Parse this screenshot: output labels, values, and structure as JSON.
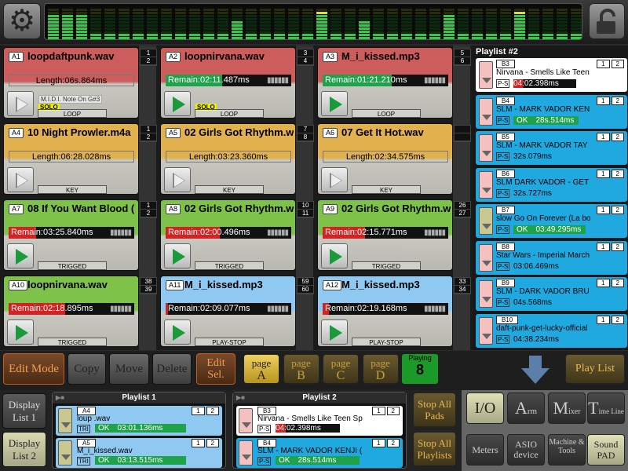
{
  "top": {
    "gear_icon": "gear-icon",
    "lock_icon": "unlock-icon"
  },
  "vu": {
    "levels": [
      0.75,
      0.75,
      0.75,
      0.2,
      0.2,
      0.2,
      0.2,
      0.2,
      0.2,
      0.2,
      0.2,
      0.2,
      0.2,
      0.6,
      0.2,
      0.2,
      0.2,
      0.2,
      0.2,
      0.9,
      0.2,
      0.2,
      0.6,
      0.2,
      0.2,
      0.2,
      0.2,
      0.2,
      0.75,
      0.2,
      0.2,
      0.2,
      0.2,
      0.9,
      0.2,
      0.2,
      0.2,
      0.2
    ]
  },
  "pads": [
    {
      "id": "A1",
      "title": "loopdaftpunk.wav",
      "kind": "len",
      "text": "Length:06s.864ms",
      "mode": "LOOP",
      "color": "#cd5c5c",
      "nums": [
        "1",
        "2"
      ],
      "playing": false,
      "midi": "M.I.D.I. Note On G#3",
      "solo": "SOLO"
    },
    {
      "id": "A2",
      "title": "loopnirvana.wav",
      "kind": "rem",
      "text": "Remain:02:11.487ms",
      "fill": 0.45,
      "fillcolor": "#1ea34a",
      "mode": "LOOP",
      "color": "#cd5c5c",
      "nums": [
        "3",
        "4"
      ],
      "playing": true,
      "solo": "SOLO"
    },
    {
      "id": "A3",
      "title": "M_i_kissed.mp3",
      "kind": "rem",
      "text": "Remain:01:21.210ms",
      "fill": 0.55,
      "fillcolor": "#1ea34a",
      "mode": "LOOP",
      "color": "#cd5c5c",
      "nums": [
        "5",
        "6"
      ],
      "playing": true
    },
    {
      "id": "A4",
      "title": "10 Night Prowler.m4a",
      "kind": "len",
      "text": "Length:06:28.028ms",
      "mode": "KEY",
      "color": "#e2b14e",
      "nums": [
        "1",
        "2"
      ],
      "playing": false
    },
    {
      "id": "A5",
      "title": "02 Girls Got Rhythm.w",
      "kind": "len",
      "text": "Length:03:23.360ms",
      "mode": "KEY",
      "color": "#e2b14e",
      "nums": [
        "7",
        "8"
      ],
      "playing": false
    },
    {
      "id": "A6",
      "title": "07 Get It Hot.wav",
      "kind": "len",
      "text": "Length:02:34.575ms",
      "mode": "KEY",
      "color": "#e2b14e",
      "nums": [
        "",
        ""
      ],
      "playing": false
    },
    {
      "id": "A7",
      "title": "08 If You Want Blood (",
      "kind": "rem",
      "text": "Remain:03:25.840ms",
      "fill": 0.22,
      "fillcolor": "#d42222",
      "mode": "TRIGGED",
      "color": "#7ec24a",
      "nums": [
        "1",
        "2"
      ],
      "playing": true
    },
    {
      "id": "A8",
      "title": "02 Girls Got Rhythm.w",
      "kind": "rem",
      "text": "Remain:02:00.496ms",
      "fill": 0.43,
      "fillcolor": "#d42222",
      "mode": "TRIGGED",
      "color": "#7ec24a",
      "nums": [
        "10",
        "11"
      ],
      "playing": true
    },
    {
      "id": "A9",
      "title": "02 Girls Got Rhythm.w",
      "kind": "rem",
      "text": "Remain:02:15.771ms",
      "fill": 0.34,
      "fillcolor": "#d42222",
      "mode": "TRIGGED",
      "color": "#7ec24a",
      "nums": [
        "26",
        "27"
      ],
      "playing": true
    },
    {
      "id": "A10",
      "title": "loopnirvana.wav",
      "kind": "rem",
      "text": "Remain:02:18.895ms",
      "fill": 0.45,
      "fillcolor": "#d42222",
      "mode": "TRIGGED",
      "color": "#7ec24a",
      "nums": [
        "38",
        "39"
      ],
      "playing": true
    },
    {
      "id": "A11",
      "title": "M_i_kissed.mp3",
      "kind": "rem",
      "text": "Remain:02:09.077ms",
      "fill": 0.02,
      "fillcolor": "#d42222",
      "mode": "PLAY-STOP",
      "color": "#8fc8f0",
      "nums": [
        "59",
        "60"
      ],
      "playing": true
    },
    {
      "id": "A12",
      "title": "M_i_kissed.mp3",
      "kind": "rem",
      "text": "Remain:02:19.168ms",
      "fill": 0.05,
      "fillcolor": "#d42222",
      "mode": "PLAY-STOP",
      "color": "#8fc8f0",
      "nums": [
        "33",
        "34"
      ],
      "playing": true
    }
  ],
  "playlist": {
    "title": "Playlist #2",
    "items": [
      {
        "code": "B3",
        "name": "Nirvana - Smells Like Teen",
        "ps": "P-S",
        "time": "04:02.398ms",
        "fill": 0.35,
        "fillcolor": "#d42222",
        "bg": "#ffffff",
        "btn": "#f4c0c0",
        "r1": "1",
        "r2": "2"
      },
      {
        "code": "B4",
        "name": "SLM - MARK VADOR KEN",
        "ps": "P-S",
        "time": "28s.514ms",
        "status": "OK",
        "fill": 1,
        "fillcolor": "#1ea34a",
        "bg": "#20a8e0",
        "btn": "#f4c0c0",
        "r1": "1",
        "r2": "2"
      },
      {
        "code": "B5",
        "name": "SLM - MARK VADOR TAY",
        "ps": "P-S",
        "time": "32s.079ms",
        "bg": "#20a8e0",
        "btn": "#f4c0c0",
        "r1": "1",
        "r2": "2"
      },
      {
        "code": "B6",
        "name": "SLM DARK VADOR - GET",
        "ps": "P-S",
        "time": "32s.727ms",
        "bg": "#20a8e0",
        "btn": "#f4c0c0",
        "r1": "1",
        "r2": "2"
      },
      {
        "code": "B7",
        "name": "slow Go On Forever (La bo",
        "ps": "P-S",
        "time": "03:49.295ms",
        "status": "OK",
        "fill": 1,
        "fillcolor": "#1ea34a",
        "bg": "#20a8e0",
        "btn": "#c8c890",
        "r1": "1",
        "r2": "2"
      },
      {
        "code": "B8",
        "name": "Star Wars - Imperial March",
        "ps": "P-S",
        "time": "03:06.469ms",
        "bg": "#20a8e0",
        "btn": "#f4c0c0",
        "r1": "1",
        "r2": "2"
      },
      {
        "code": "B9",
        "name": "SLM - DARK VADOR BRU",
        "ps": "P-S",
        "time": "04s.568ms",
        "bg": "#20a8e0",
        "btn": "#f4c0c0",
        "r1": "1",
        "r2": "2"
      },
      {
        "code": "B10",
        "name": "daft-punk-get-lucky-official",
        "ps": "P-S",
        "time": "04:38.234ms",
        "bg": "#20a8e0",
        "btn": "#f4c0c0",
        "r1": "1",
        "r2": "2"
      }
    ]
  },
  "edit": {
    "edit_mode": "Edit Mode",
    "copy": "Copy",
    "move": "Move",
    "delete": "Delete",
    "edit_sel": "Edit Sel."
  },
  "pages": [
    {
      "top": "page",
      "letter": "A",
      "on": true
    },
    {
      "top": "page",
      "letter": "B",
      "on": false
    },
    {
      "top": "page",
      "letter": "C",
      "on": false
    },
    {
      "top": "page",
      "letter": "D",
      "on": false
    }
  ],
  "playing": {
    "label": "Playing",
    "count": "8"
  },
  "play_list_label": "Play List",
  "display": {
    "list1": "Display List 1",
    "list2": "Display List 2"
  },
  "mini1": {
    "title": "Playlist 1",
    "items": [
      {
        "code": "A4",
        "name": "loup .wav",
        "ps": "TRI",
        "status": "OK",
        "time": "03:01.136ms",
        "bg": "#8fc8f0",
        "btn": "#c8c890",
        "fillcolor": "#1ea34a"
      },
      {
        "code": "A5",
        "name": "M_i_kissed.wav",
        "ps": "TRI",
        "status": "OK",
        "time": "03:13.515ms",
        "bg": "#8fc8f0",
        "btn": "#c8c890",
        "fillcolor": "#1ea34a"
      }
    ]
  },
  "mini2": {
    "title": "Playlist 2",
    "items": [
      {
        "code": "B3",
        "name": "Nirvana - Smells Like Teen Sp",
        "ps": "P-S",
        "time": "04:02.398ms",
        "bg": "#ffffff",
        "btn": "#f4c0c0",
        "fillcolor": "#d42222"
      },
      {
        "code": "B4",
        "name": "SLM - MARK VADOR KENJI (",
        "ps": "P-S",
        "status": "OK",
        "time": "28s.514ms",
        "bg": "#20a8e0",
        "btn": "#f4c0c0",
        "fillcolor": "#1ea34a"
      }
    ]
  },
  "stop": {
    "pads": "Stop All Pads",
    "playlists": "Stop All Playlists"
  },
  "io": {
    "io": "I/O",
    "arm_big": "A",
    "arm_small": "rm",
    "mix_big": "M",
    "mix_small": "ixer",
    "time_big": "T",
    "time_small": "ime Line",
    "meters": "Meters",
    "asio": "ASIO device",
    "machine": "Machine & Tools",
    "sound": "Sound PAD"
  }
}
